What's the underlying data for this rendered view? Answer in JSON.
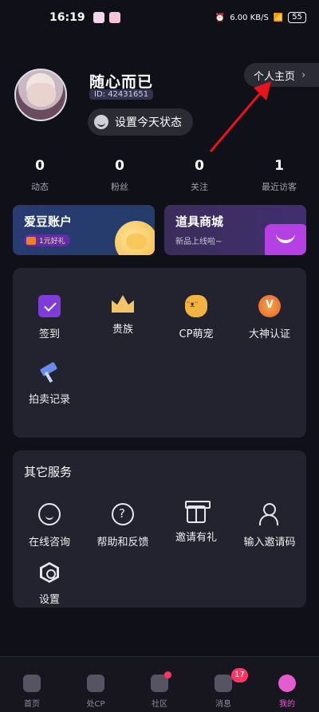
{
  "status_bar": {
    "time": "16:19",
    "network_speed": "6.00 KB/S",
    "battery": "55"
  },
  "profile": {
    "username": "随心而已",
    "user_id": "ID: 42431651",
    "status_button": "设置今天状态",
    "homepage_button": "个人主页"
  },
  "stats": [
    {
      "value": "0",
      "label": "动态"
    },
    {
      "value": "0",
      "label": "粉丝"
    },
    {
      "value": "0",
      "label": "关注"
    },
    {
      "value": "1",
      "label": "最近访客"
    }
  ],
  "cards": {
    "account": {
      "title": "爱豆账户",
      "tag": "1元好礼"
    },
    "mall": {
      "title": "道具商城",
      "subtitle": "新品上线啦~"
    }
  },
  "features": [
    {
      "label": "签到",
      "icon": "calendar-check-icon"
    },
    {
      "label": "贵族",
      "icon": "crown-icon"
    },
    {
      "label": "CP萌宠",
      "icon": "cat-icon"
    },
    {
      "label": "大神认证",
      "icon": "medal-icon"
    },
    {
      "label": "拍卖记录",
      "icon": "gavel-icon"
    }
  ],
  "services": {
    "title": "其它服务",
    "items": [
      {
        "label": "在线咨询",
        "icon": "chat-smile-icon"
      },
      {
        "label": "帮助和反馈",
        "icon": "help-icon"
      },
      {
        "label": "邀请有礼",
        "icon": "gift-icon"
      },
      {
        "label": "输入邀请码",
        "icon": "person-check-icon"
      },
      {
        "label": "设置",
        "icon": "settings-icon"
      }
    ]
  },
  "tabbar": [
    {
      "label": "首页",
      "icon": "home-icon"
    },
    {
      "label": "处CP",
      "icon": "heart-icon"
    },
    {
      "label": "社区",
      "icon": "planet-icon"
    },
    {
      "label": "消息",
      "icon": "message-icon",
      "badge": "17"
    },
    {
      "label": "我的",
      "icon": "me-icon"
    }
  ],
  "colors": {
    "accent": "#e55bd0",
    "badge": "#ff3565",
    "annotation_arrow": "#e8131b"
  }
}
